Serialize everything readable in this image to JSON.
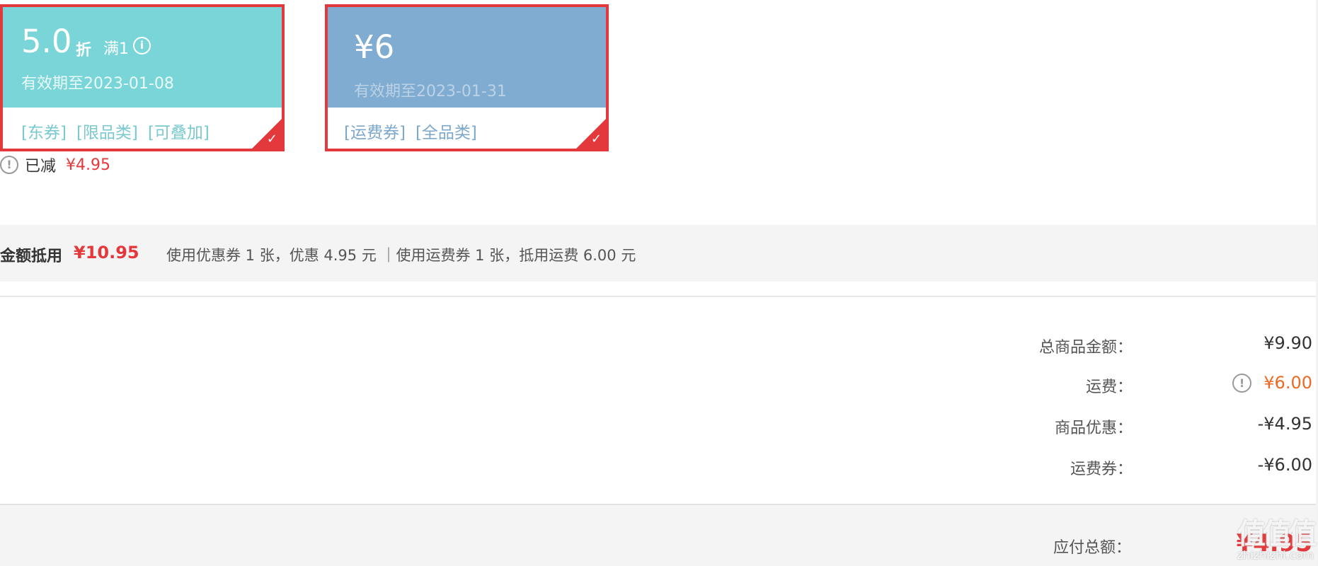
{
  "coupons": [
    {
      "value": "5.0",
      "unit": "折",
      "condition": "满1",
      "info_icon": "info-circle-icon",
      "expire": "有效期至2023-01-08",
      "tags": [
        "[东券]",
        "[限品类]",
        "[可叠加]"
      ],
      "selected": true,
      "top_color": "#79d5d8"
    },
    {
      "value": "¥6",
      "expire": "有效期至2023-01-31",
      "tags": [
        "[运费券]",
        "[全品类]"
      ],
      "selected": true,
      "top_color": "#7facd0"
    }
  ],
  "reduced": {
    "icon": "warning-circle-icon",
    "label": "已减",
    "value": "¥4.95"
  },
  "summary": {
    "title": "金额抵用",
    "amount": "¥10.95",
    "detail": "使用优惠券 1 张，优惠 4.95 元 ｜使用运费券 1 张，抵用运费 6.00 元"
  },
  "price_rows": [
    {
      "label": "总商品金额：",
      "value": "¥9.90"
    },
    {
      "label": "运费：",
      "value": "¥6.00",
      "icon": "warning-circle-icon"
    },
    {
      "label": "商品优惠：",
      "value": "-¥4.95"
    },
    {
      "label": "运费券：",
      "value": "-¥6.00"
    }
  ],
  "total": {
    "label": "应付总额：",
    "value": "¥4.95"
  },
  "watermark": {
    "glyphs": "值值值",
    "text": "zhizhizhi.com"
  },
  "colors": {
    "accent_red": "#e4393c",
    "freight_orange": "#ee6a24"
  }
}
